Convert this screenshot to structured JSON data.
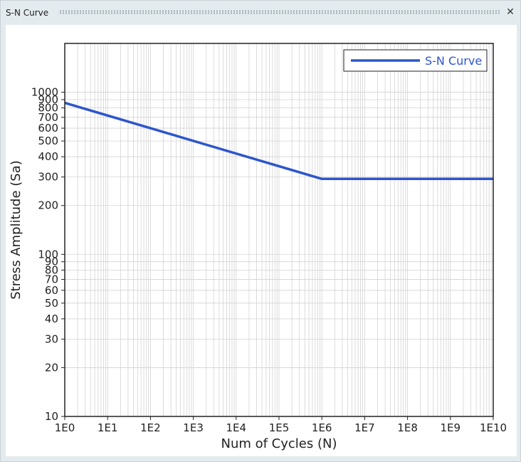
{
  "window": {
    "title": "S-N Curve",
    "close_glyph": "✕"
  },
  "colors": {
    "series": "#2d56cc",
    "grid": "#d3d3d3",
    "frame": "#222222"
  },
  "chart_data": {
    "type": "line",
    "x_scale": "log",
    "y_scale": "log",
    "xlabel": "Num of Cycles (N)",
    "ylabel": "Stress Amplitude (Sa)",
    "xlim": [
      1,
      10000000000
    ],
    "ylim": [
      10,
      2000
    ],
    "x_ticks": [
      {
        "value": 1,
        "label": "1E0"
      },
      {
        "value": 10,
        "label": "1E1"
      },
      {
        "value": 100,
        "label": "1E2"
      },
      {
        "value": 1000,
        "label": "1E3"
      },
      {
        "value": 10000,
        "label": "1E4"
      },
      {
        "value": 100000,
        "label": "1E5"
      },
      {
        "value": 1000000,
        "label": "1E6"
      },
      {
        "value": 10000000,
        "label": "1E7"
      },
      {
        "value": 100000000,
        "label": "1E8"
      },
      {
        "value": 1000000000,
        "label": "1E9"
      },
      {
        "value": 10000000000,
        "label": "1E10"
      }
    ],
    "y_ticks": [
      {
        "value": 10,
        "label": "10"
      },
      {
        "value": 20,
        "label": "20"
      },
      {
        "value": 30,
        "label": "30"
      },
      {
        "value": 40,
        "label": "40"
      },
      {
        "value": 50,
        "label": "50"
      },
      {
        "value": 60,
        "label": "60"
      },
      {
        "value": 70,
        "label": "70"
      },
      {
        "value": 80,
        "label": "80"
      },
      {
        "value": 90,
        "label": "90"
      },
      {
        "value": 100,
        "label": "100"
      },
      {
        "value": 200,
        "label": "200"
      },
      {
        "value": 300,
        "label": "300"
      },
      {
        "value": 400,
        "label": "400"
      },
      {
        "value": 500,
        "label": "500"
      },
      {
        "value": 600,
        "label": "600"
      },
      {
        "value": 700,
        "label": "700"
      },
      {
        "value": 800,
        "label": "800"
      },
      {
        "value": 900,
        "label": "900"
      },
      {
        "value": 1000,
        "label": "1000"
      }
    ],
    "grid": true,
    "legend_position": "top-right",
    "series": [
      {
        "name": "S-N Curve",
        "x": [
          1,
          1000000,
          10000000000
        ],
        "y": [
          860,
          292,
          292
        ]
      }
    ]
  }
}
